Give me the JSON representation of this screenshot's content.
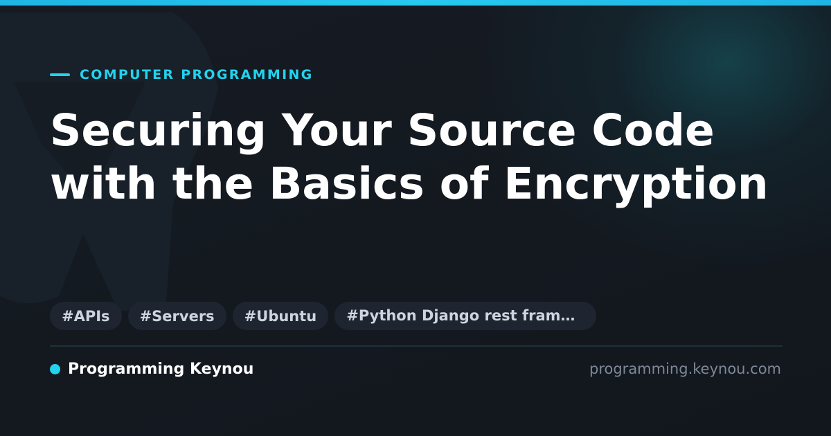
{
  "category": "COMPUTER PROGRAMMING",
  "title": "Securing Your Source Code with the Basics of Encryption",
  "tags": [
    "#APIs",
    "#Servers",
    "#Ubuntu",
    "#Python Django rest framework"
  ],
  "brand": {
    "name": "Programming Keynou",
    "url": "programming.keynou.com"
  },
  "colors": {
    "accent": "#22d3ee",
    "background": "#141920",
    "title": "#ffffff",
    "tag_background": "#1e2530",
    "tag_text": "#cdd5df",
    "url_text": "#7e8896"
  },
  "icons": {
    "eyebrow": "accent-dash",
    "brand": "brand-dot-icon"
  }
}
